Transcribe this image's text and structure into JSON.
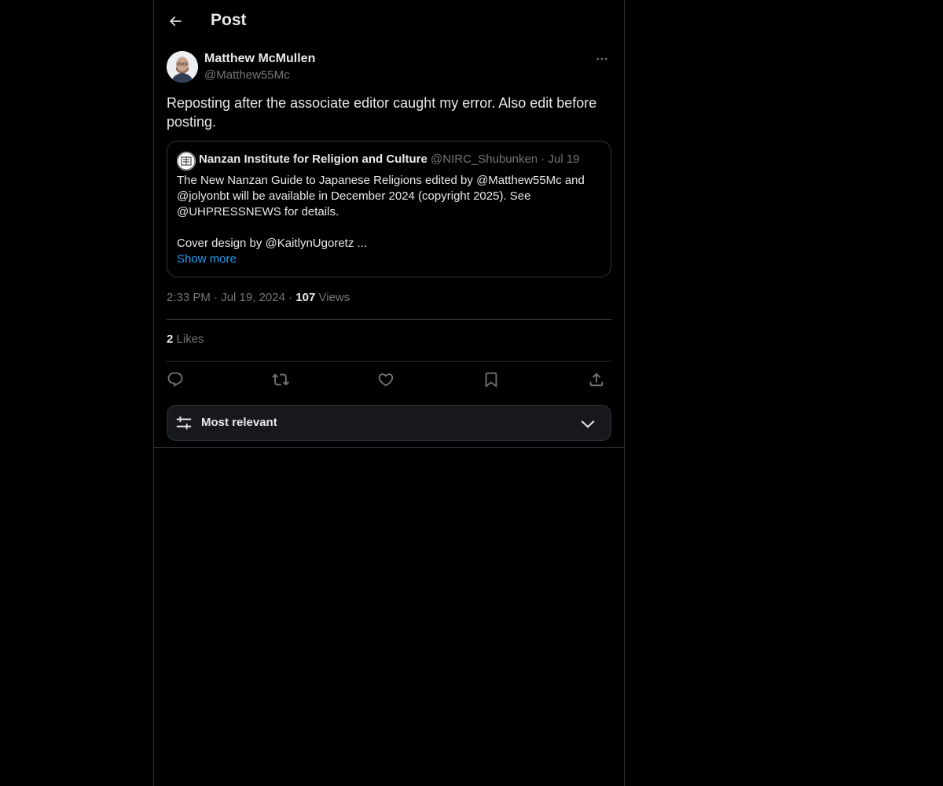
{
  "header": {
    "title": "Post"
  },
  "post": {
    "author_name": "Matthew McMullen",
    "author_handle": "@Matthew55Mc",
    "text": "Reposting after the associate editor caught my error. Also edit before posting.",
    "time": "2:33 PM",
    "date": "Jul 19, 2024",
    "views_count": "107",
    "views_label": "Views",
    "likes_count": "2",
    "likes_label": "Likes",
    "separator": "·"
  },
  "quote": {
    "author_name": "Nanzan Institute for Religion and Culture",
    "author_handle": "@NIRC_Shubunken",
    "date": "Jul 19",
    "line1": "The New Nanzan Guide to Japanese Religions edited by @Matthew55Mc and @jolyonbt will be available in December 2024 (copyright 2025). See @UHPRESSNEWS for details.",
    "line2": "Cover design by @KaitlynUgoretz ...",
    "show_more": "Show more"
  },
  "sort": {
    "label": "Most relevant"
  },
  "icons": {
    "back": "arrow-left-icon",
    "more": "more-horizontal-icon",
    "reply": "reply-icon",
    "repost": "repost-icon",
    "like": "heart-icon",
    "bookmark": "bookmark-icon",
    "share": "share-icon",
    "sort": "sliders-icon",
    "chevron": "chevron-down-icon"
  },
  "colors": {
    "background": "#000000",
    "border": "#2f3336",
    "muted": "#71767b",
    "link": "#1d9bf0"
  }
}
